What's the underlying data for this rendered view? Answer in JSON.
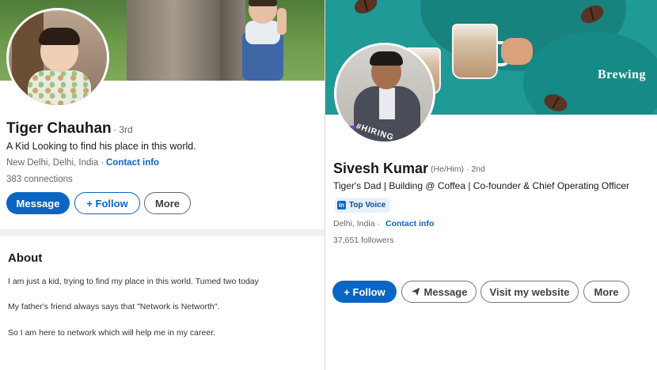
{
  "left_profile": {
    "name": "Tiger Chauhan",
    "degree": "· 3rd",
    "headline": "A Kid Looking to find his place in this world.",
    "location": "New Delhi, Delhi, India ·",
    "contact_info": "Contact info",
    "connections": "383 connections",
    "buttons": {
      "message": "Message",
      "follow": "+ Follow",
      "more": "More"
    },
    "about": {
      "title": "About",
      "lines": [
        "I am just a kid, trying to find my place in this world. Tumed two today",
        "My father's friend always says that \"Network is Networth\".",
        "So I am here to network which will help me in my career."
      ]
    }
  },
  "right_profile": {
    "banner_text": "Brewing",
    "hiring_label": "#HIRING",
    "name": "Sivesh Kumar",
    "pronouns": "(He/Him) · 2nd",
    "headline": "Tiger's Dad | Building @ Coffea | Co-founder & Chief Operating Officer",
    "badge": {
      "logo": "in",
      "label": "Top Voice"
    },
    "location": "Delhi, India ·",
    "contact_info": "Contact info",
    "followers": "37,651 followers",
    "buttons": {
      "follow": "+ Follow",
      "message": "Message",
      "website": "Visit my website",
      "more": "More"
    }
  },
  "colors": {
    "linkedin_blue": "#0a66c2",
    "banner_teal": "#1f9a96",
    "hiring_purple": "#7a3fc0"
  },
  "icons": {
    "message_send": "paper-plane-icon",
    "linkedin_logo": "linkedin-logo-icon"
  }
}
